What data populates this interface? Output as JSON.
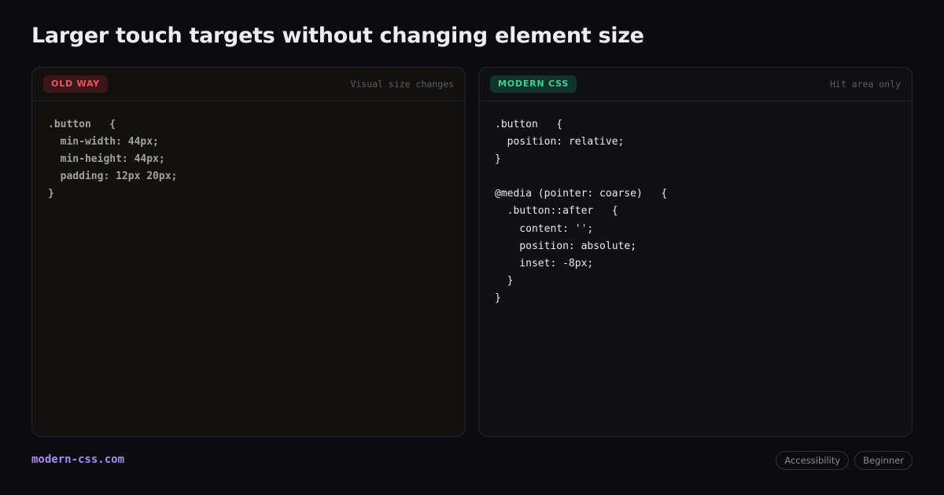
{
  "header": {
    "title": "Larger touch targets without changing element size"
  },
  "old_panel": {
    "badge": "OLD WAY",
    "note": "Visual size changes",
    "code": ".button   {\n  min-width: 44px;\n  min-height: 44px;\n  padding: 12px 20px;\n}"
  },
  "modern_panel": {
    "badge": "MODERN CSS",
    "note": "Hit area only",
    "code": ".button   {\n  position: relative;\n}\n\n@media (pointer: coarse)   {\n  .button::after   {\n    content: '';\n    position: absolute;\n    inset: -8px;\n  }\n}"
  },
  "footer": {
    "brand": "modern-css.com",
    "tags": [
      "Accessibility",
      "Beginner"
    ]
  },
  "colors": {
    "background": "#0b0b10",
    "old_accent": "#f0555a",
    "modern_accent": "#35d39b",
    "brand": "#a78bfa"
  }
}
